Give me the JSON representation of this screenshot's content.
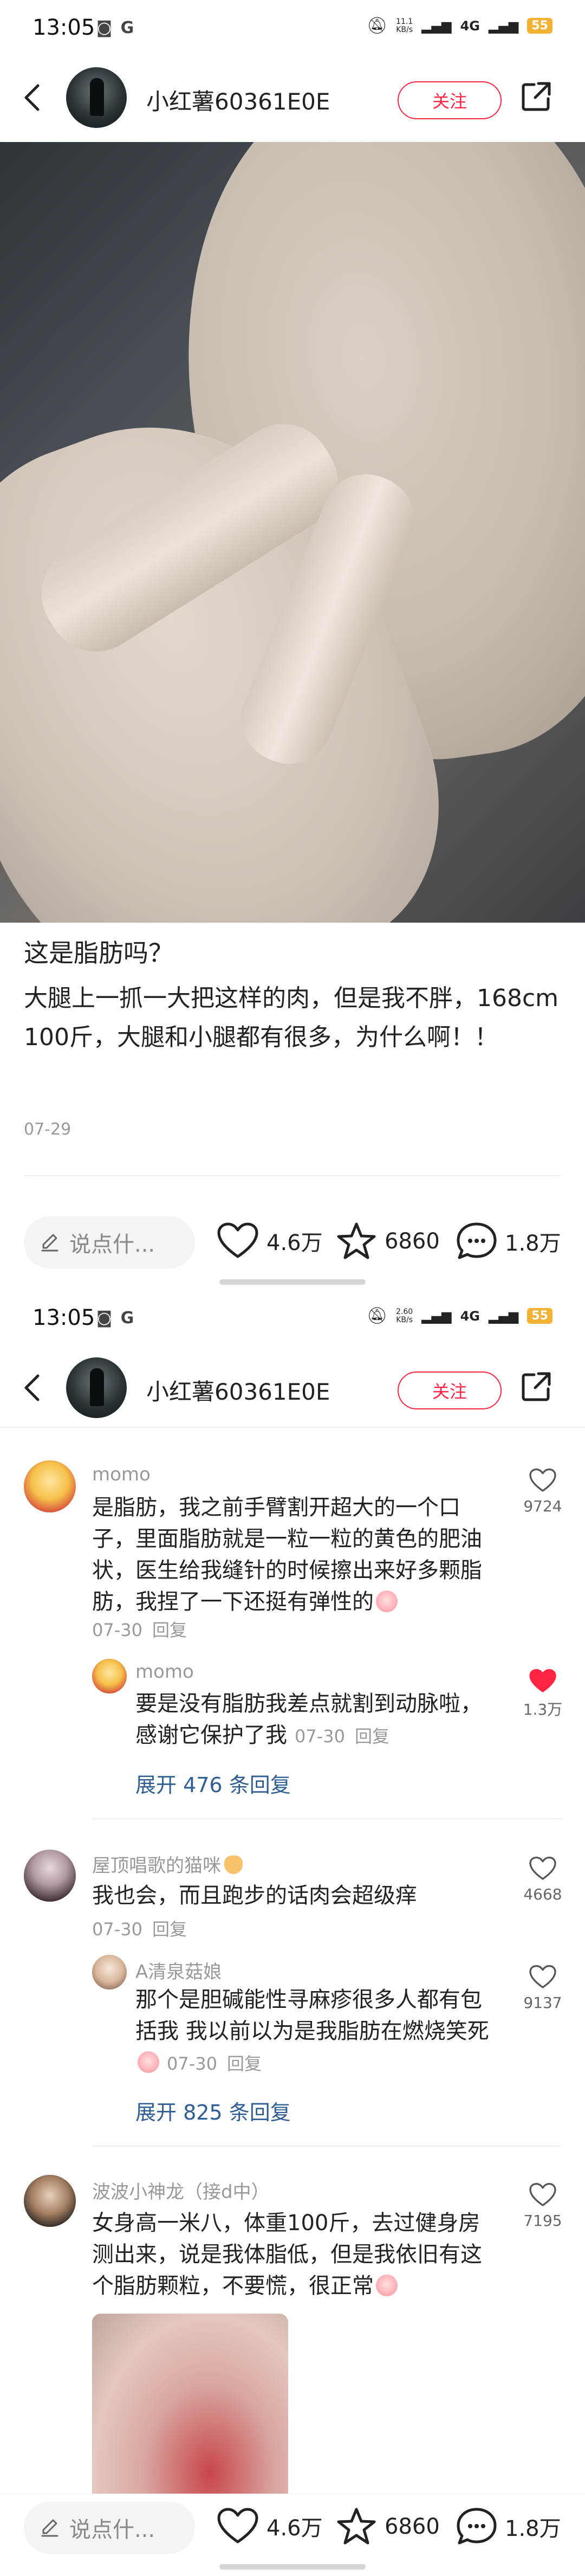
{
  "status_bar": {
    "time": "13:05",
    "speed_top": {
      "value": "11.1",
      "unit": "KB/s"
    },
    "speed_bottom": {
      "value": "2.60",
      "unit": "KB/s"
    },
    "network": "4G",
    "battery": "55",
    "icons": [
      "message-icon",
      "g-icon",
      "mute-icon",
      "signal-icon",
      "wifi-icon"
    ]
  },
  "nav": {
    "username": "小红薯60361E0E",
    "follow_label": "关注"
  },
  "post": {
    "title": "这是脂肪吗？",
    "body": "大腿上一抓一大把这样的肉，但是我不胖，168cm 100斤，大腿和小腿都有很多，为什么啊！！",
    "date": "07-29"
  },
  "bottom_bar": {
    "comment_placeholder": "说点什...",
    "likes": "4.6万",
    "collects": "6860",
    "comments": "1.8万"
  },
  "comments": [
    {
      "name": "momo",
      "text": "是脂肪，我之前手臂割开超大的一个口子，里面脂肪就是一粒一粒的黄色的肥油状，医生给我缝针的时候擦出来好多颗脂肪，我捏了一下还挺有弹性的",
      "date": "07-30",
      "reply_label": "回复",
      "likes": "9724",
      "replies": [
        {
          "name": "momo",
          "text": "要是没有脂肪我差点就割到动脉啦，感谢它保护了我",
          "date": "07-30",
          "reply_label": "回复",
          "likes": "1.3万",
          "liked": true
        }
      ],
      "expand": "展开 476 条回复"
    },
    {
      "name": "屋顶唱歌的猫咪",
      "text": "我也会，而且跑步的话肉会超级痒",
      "date": "07-30",
      "reply_label": "回复",
      "likes": "4668",
      "replies": [
        {
          "name": "A清泉菇娘",
          "text": "那个是胆碱能性寻麻疹很多人都有包括我 我以前以为是我脂肪在燃烧笑死",
          "date": "07-30",
          "reply_label": "回复",
          "likes": "9137",
          "liked": false
        }
      ],
      "expand": "展开 825 条回复"
    },
    {
      "name": "波波小神龙（接d中）",
      "text": "女身高一米八，体重100斤，去过健身房测出来，说是我体脂低，但是我依旧有这个脂肪颗粒，不要慌，很正常",
      "likes": "7195"
    }
  ],
  "colors": {
    "accent": "#ff2442",
    "link": "#2e5e94",
    "muted": "#999999",
    "battery": "#f3b234"
  }
}
